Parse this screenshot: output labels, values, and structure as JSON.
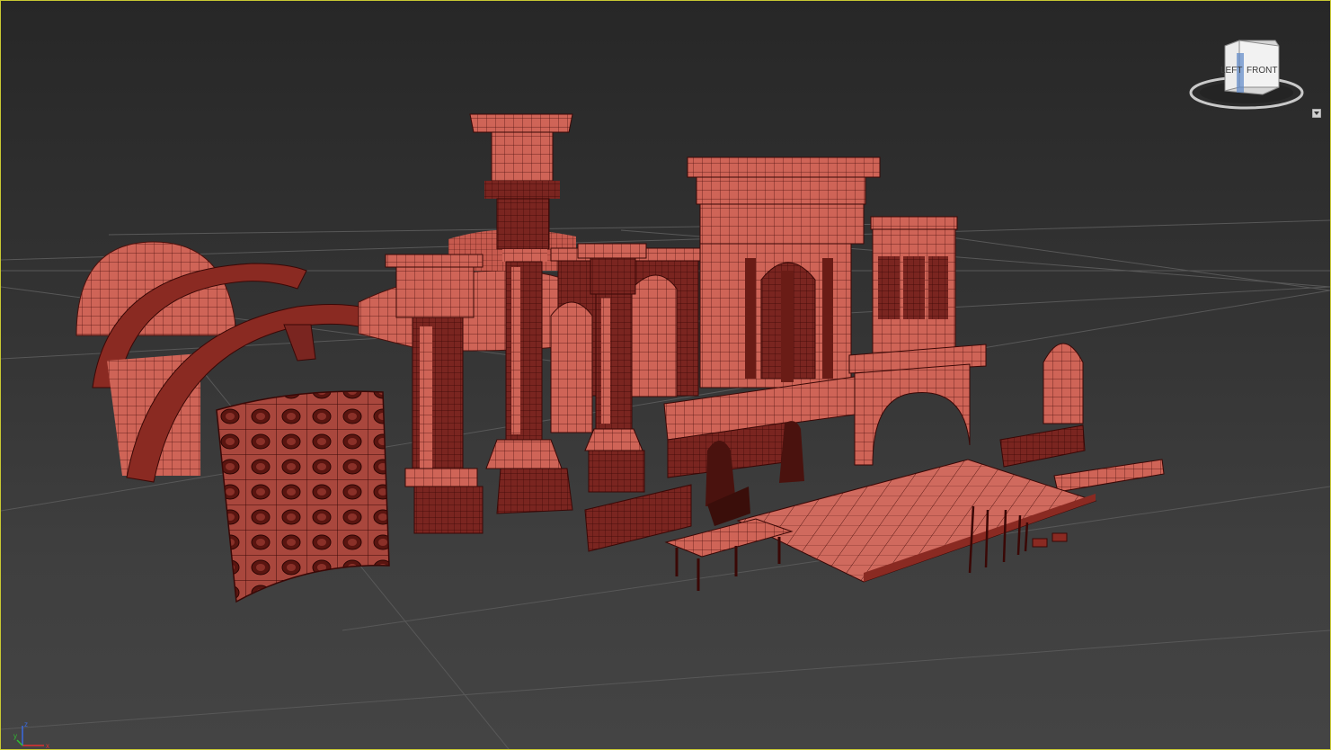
{
  "viewport": {
    "border_color": "#c8c832",
    "model_color": "#d0675c",
    "wire_color": "#4a100c",
    "grid_color": "#575757"
  },
  "viewcube": {
    "left_label": "LEFT",
    "front_label": "FRONT",
    "menu_icon": "chevron-down-icon"
  },
  "axis": {
    "x_label": "x",
    "y_label": "y",
    "z_label": "z"
  }
}
